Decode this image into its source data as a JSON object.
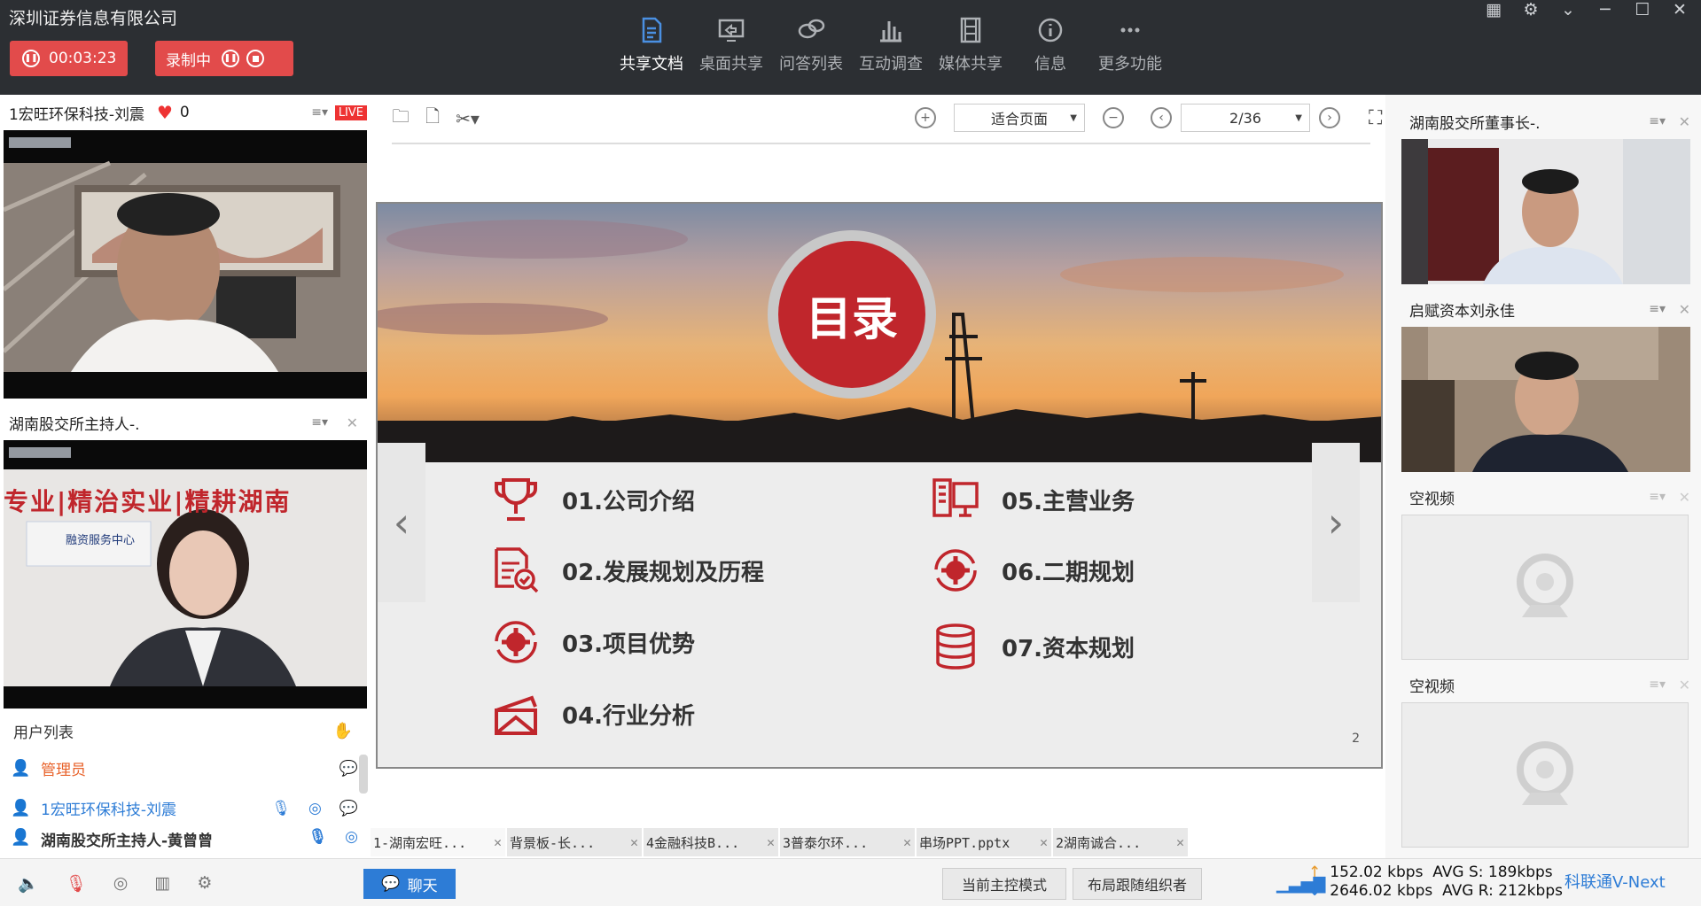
{
  "top": {
    "org_name": "深圳证券信息有限公司",
    "timer": "00:03:23",
    "recording_label": "录制中",
    "nav": [
      {
        "label": "共享文档",
        "icon": "document-icon",
        "active": true
      },
      {
        "label": "桌面共享",
        "icon": "screen-share-icon",
        "active": false
      },
      {
        "label": "问答列表",
        "icon": "qa-bubbles-icon",
        "active": false
      },
      {
        "label": "互动调查",
        "icon": "bar-chart-icon",
        "active": false
      },
      {
        "label": "媒体共享",
        "icon": "film-icon",
        "active": false
      },
      {
        "label": "信息",
        "icon": "info-icon",
        "active": false
      },
      {
        "label": "更多功能",
        "icon": "more-dots-icon",
        "active": false
      }
    ]
  },
  "left": {
    "video1_title": "1宏旺环保科技-刘震",
    "likes": "0",
    "live_badge": "LIVE",
    "video2_title": "湖南股交所主持人-.",
    "video2_banner": "专业|精治实业|精耕湖南",
    "video2_sign": "融资服务中心"
  },
  "user_list": {
    "title": "用户列表",
    "users": [
      {
        "name": "管理员",
        "color": "#e8622a"
      },
      {
        "name": "1宏旺环保科技-刘震",
        "color": "#2d7cd6"
      },
      {
        "name": "湖南股交所主持人-黄曾曾",
        "color": "#222"
      }
    ]
  },
  "doc": {
    "zoom": "适合页面",
    "page": "2/36",
    "slide": {
      "title": "目录",
      "items_left": [
        "01.公司介绍",
        "02.发展规划及历程",
        "03.项目优势",
        "04.行业分析"
      ],
      "items_right": [
        "05.主营业务",
        "06.二期规划",
        "07.资本规划"
      ],
      "page_number": "2"
    },
    "tabs": [
      "1-湖南宏旺...",
      "背景板-长...",
      "4金融科技B...",
      "3普泰尔环...",
      "串场PPT.pptx",
      "2湖南诚合..."
    ]
  },
  "right": {
    "video1_title": "湖南股交所董事长-.",
    "video2_title": "启赋资本刘永佳",
    "empty1_title": "空视频",
    "empty2_title": "空视频"
  },
  "bottom": {
    "chat": "聊天",
    "master_mode": "当前主控模式",
    "layout_follow": "布局跟随组织者",
    "up_rate": "152.02 kbps",
    "up_avg": "AVG S: 189kbps",
    "down_rate": "2646.02 kbps",
    "down_avg": "AVG R: 212kbps",
    "brand": "科联通V-Next"
  },
  "colors": {
    "accent": "#2d7cd6",
    "record": "#e24b4b",
    "slide_red": "#c0262c"
  }
}
